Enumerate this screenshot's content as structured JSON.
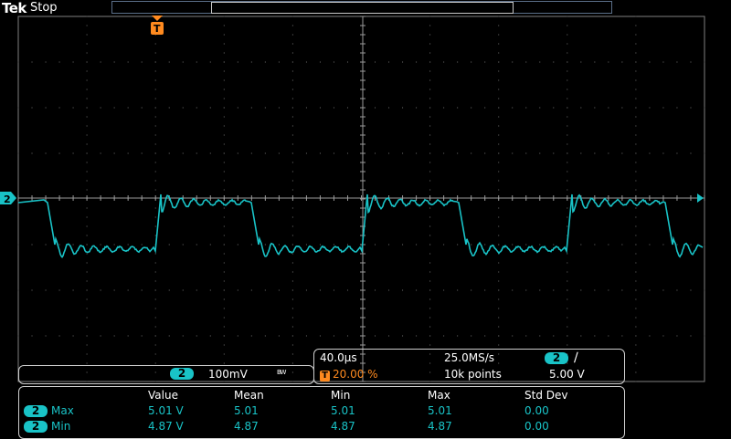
{
  "header": {
    "brand": "Tek",
    "state": "Stop"
  },
  "trigger": {
    "marker": "T",
    "level_badge": "T",
    "level_value": "20.00 %",
    "slope_icon": "rising-edge-icon"
  },
  "channel": {
    "id": "2",
    "scale": "100mV",
    "bw_flag": "BW",
    "color": "#19c3c7"
  },
  "timebase": {
    "horizontal": "40.0µs",
    "sample_rate": "25.0MS/s",
    "record_length": "10k points",
    "trigger_level": "5.00 V"
  },
  "measurements": {
    "headers": [
      "Value",
      "Mean",
      "Min",
      "Max",
      "Std Dev"
    ],
    "rows": [
      {
        "channel": "2",
        "type": "Max",
        "value": "5.01 V",
        "mean": "5.01",
        "min": "5.01",
        "max": "5.01",
        "std": "0.00"
      },
      {
        "channel": "2",
        "type": "Min",
        "value": "4.87 V",
        "mean": "4.87",
        "min": "4.87",
        "max": "4.87",
        "std": "0.00"
      }
    ]
  },
  "colors": {
    "grid": "#7f7f7f",
    "accent_orange": "#ff8a1f",
    "trace": "#19c3c7"
  }
}
